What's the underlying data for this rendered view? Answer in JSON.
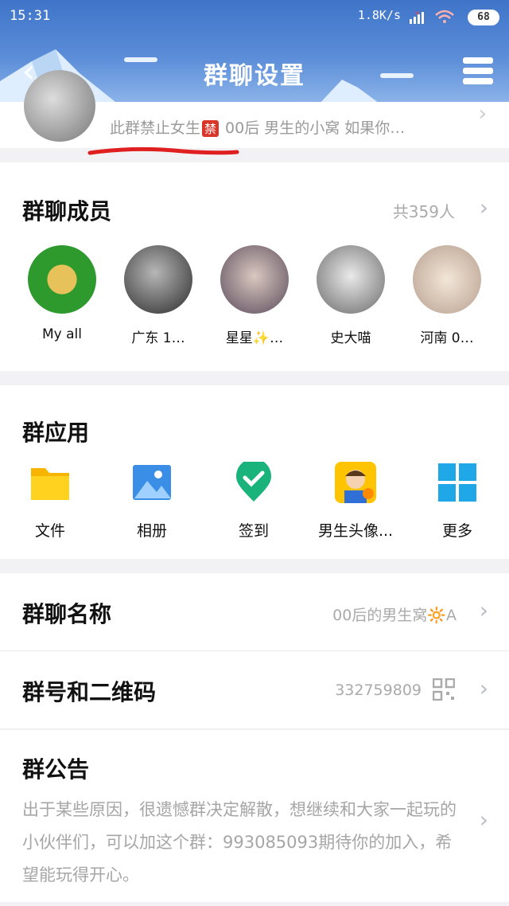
{
  "status_bar": {
    "time": "15:31",
    "net_speed": "1.8K/s",
    "battery": "68"
  },
  "header": {
    "title": "群聊设置"
  },
  "group_profile": {
    "desc_before_badge": "此群禁止女生",
    "badge": "禁",
    "desc_after_badge": "00后 男生的小窝  如果你…"
  },
  "members": {
    "title": "群聊成员",
    "count": "共359人",
    "list": [
      {
        "name": "My all"
      },
      {
        "name": "广东 1…"
      },
      {
        "name": "星星✨…"
      },
      {
        "name": "史大喵"
      },
      {
        "name": "河南 0…"
      }
    ]
  },
  "apps": {
    "title": "群应用",
    "list": [
      {
        "label": "文件",
        "icon": "folder-icon"
      },
      {
        "label": "相册",
        "icon": "photo-album-icon"
      },
      {
        "label": "签到",
        "icon": "checkin-icon"
      },
      {
        "label": "男生头像...",
        "icon": "avatar-app-icon"
      },
      {
        "label": "更多",
        "icon": "grid-more-icon"
      }
    ]
  },
  "settings": {
    "name_label": "群聊名称",
    "name_value": "00后的男生窝🔆A",
    "number_label": "群号和二维码",
    "number_value": "332759809"
  },
  "notice": {
    "label": "群公告",
    "text": "出于某些原因，很遗憾群决定解散，想继续和大家一起玩的小伙伴们，可以加这个群：993085093期待你的加入，希望能玩得开心。"
  },
  "colors": {
    "header": "#4a7fd0",
    "ban_badge": "#d9362a",
    "underline": "#e02020"
  }
}
